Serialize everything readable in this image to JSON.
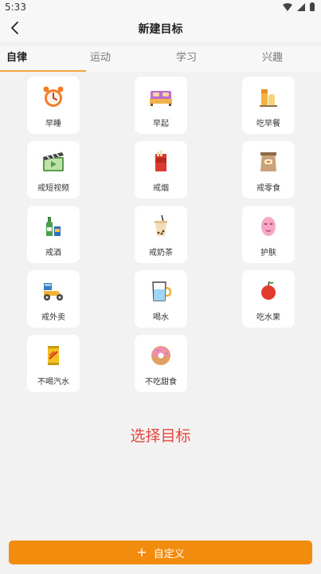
{
  "status_bar": {
    "time": "5:33"
  },
  "header": {
    "title": "新建目标"
  },
  "tabs": [
    {
      "label": "自律"
    },
    {
      "label": "运动"
    },
    {
      "label": "学习"
    },
    {
      "label": "兴趣"
    }
  ],
  "goals": [
    {
      "label": "早睡",
      "icon": "alarm-clock-icon"
    },
    {
      "label": "早起",
      "icon": "bed-icon"
    },
    {
      "label": "吃早餐",
      "icon": "breakfast-icon"
    },
    {
      "label": "戒短视频",
      "icon": "video-clapper-icon"
    },
    {
      "label": "戒烟",
      "icon": "cigarette-pack-icon"
    },
    {
      "label": "戒零食",
      "icon": "snack-bag-icon"
    },
    {
      "label": "戒酒",
      "icon": "bottles-icon"
    },
    {
      "label": "戒奶茶",
      "icon": "milk-tea-icon"
    },
    {
      "label": "护肤",
      "icon": "face-mask-icon"
    },
    {
      "label": "戒外卖",
      "icon": "delivery-scooter-icon"
    },
    {
      "label": "喝水",
      "icon": "water-cup-icon"
    },
    {
      "label": "吃水果",
      "icon": "apple-icon"
    },
    {
      "label": "不喝汽水",
      "icon": "soda-can-icon"
    },
    {
      "label": "不吃甜食",
      "icon": "donut-icon"
    }
  ],
  "prompt": "选择目标",
  "custom_button": {
    "label": "自定义",
    "icon": "plus-icon"
  },
  "colors": {
    "accent": "#f28c0f",
    "prompt": "#e8453c",
    "tab_underline": "#f5a13c"
  }
}
